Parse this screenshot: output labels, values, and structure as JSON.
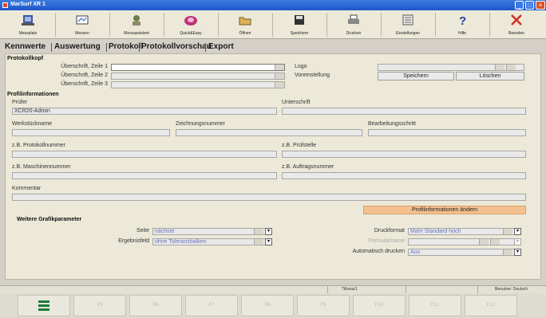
{
  "window": {
    "title": "MarSurf XR 1"
  },
  "toolbar": [
    {
      "label": "Messplatz",
      "icon": "measuring-station-icon"
    },
    {
      "label": "Messen",
      "icon": "measure-icon"
    },
    {
      "label": "Messassistent",
      "icon": "assistant-icon"
    },
    {
      "label": "Quick&Easy",
      "icon": "quick-easy-icon"
    },
    {
      "label": "Öffnen",
      "icon": "open-folder-icon"
    },
    {
      "label": "Speichern",
      "icon": "save-disk-icon"
    },
    {
      "label": "Drucken",
      "icon": "printer-icon"
    },
    {
      "label": "Einstellungen",
      "icon": "settings-icon"
    },
    {
      "label": "Hilfe",
      "icon": "help-icon"
    },
    {
      "label": "Beenden",
      "icon": "exit-icon"
    }
  ],
  "tabs": [
    "Kennwerte",
    "Auswertung",
    "Protokoll",
    "Protokollvorschau",
    "Export"
  ],
  "protokollkopf": {
    "heading": "Protokollkopf",
    "line1_label": "Überschrift, Zeile 1",
    "line2_label": "Überschrift, Zeile 2",
    "line3_label": "Überschrift, Zeile 3",
    "logo_label": "Logo",
    "preset_label": "Voreinstellung",
    "save_button": "Speichern",
    "delete_button": "Löschen"
  },
  "profil": {
    "heading": "Profilinformationen",
    "pruefer_label": "Prüfer",
    "pruefer_value": "XCR20-Admin",
    "unterschrift_label": "Unterschrift",
    "werkstueck_label": "Werkstückname",
    "zeichnung_label": "Zeichnungsnummer",
    "bearbeitung_label": "Bearbeitungsschritt",
    "protokollnr_label": "z.B. Protokollnummer",
    "pruefstelle_label": "z.B. Prüfstelle",
    "maschinennr_label": "z.B. Maschinennummer",
    "auftragsnr_label": "z.B. Auftragsnummer",
    "kommentar_label": "Kommentar",
    "change_button": "Profilinformationen ändern"
  },
  "grafik": {
    "heading": "Weitere Grafikparameter",
    "seite_label": "Seite",
    "seite_value": "nächste",
    "ergebnis_label": "Ergebnisfeld",
    "ergebnis_value": "ohne Toleranzbalken",
    "druckformat_label": "Druckformat",
    "druckformat_value": "Mahr Standard hoch",
    "formular_label": "Formularname",
    "autodruck_label": "Automatisch drucken",
    "autodruck_value": "Aus"
  },
  "status": {
    "job": "Tiltvisur1",
    "user": "Benutzer: Deutsch"
  },
  "fkeys": [
    "F5",
    "F6",
    "F7",
    "F8",
    "F9",
    "F10",
    "F11",
    "F12"
  ],
  "colors": {
    "title_blue": "#1f56c9",
    "orange_button": "#f3c08e",
    "value_blue": "#6a74b8"
  }
}
